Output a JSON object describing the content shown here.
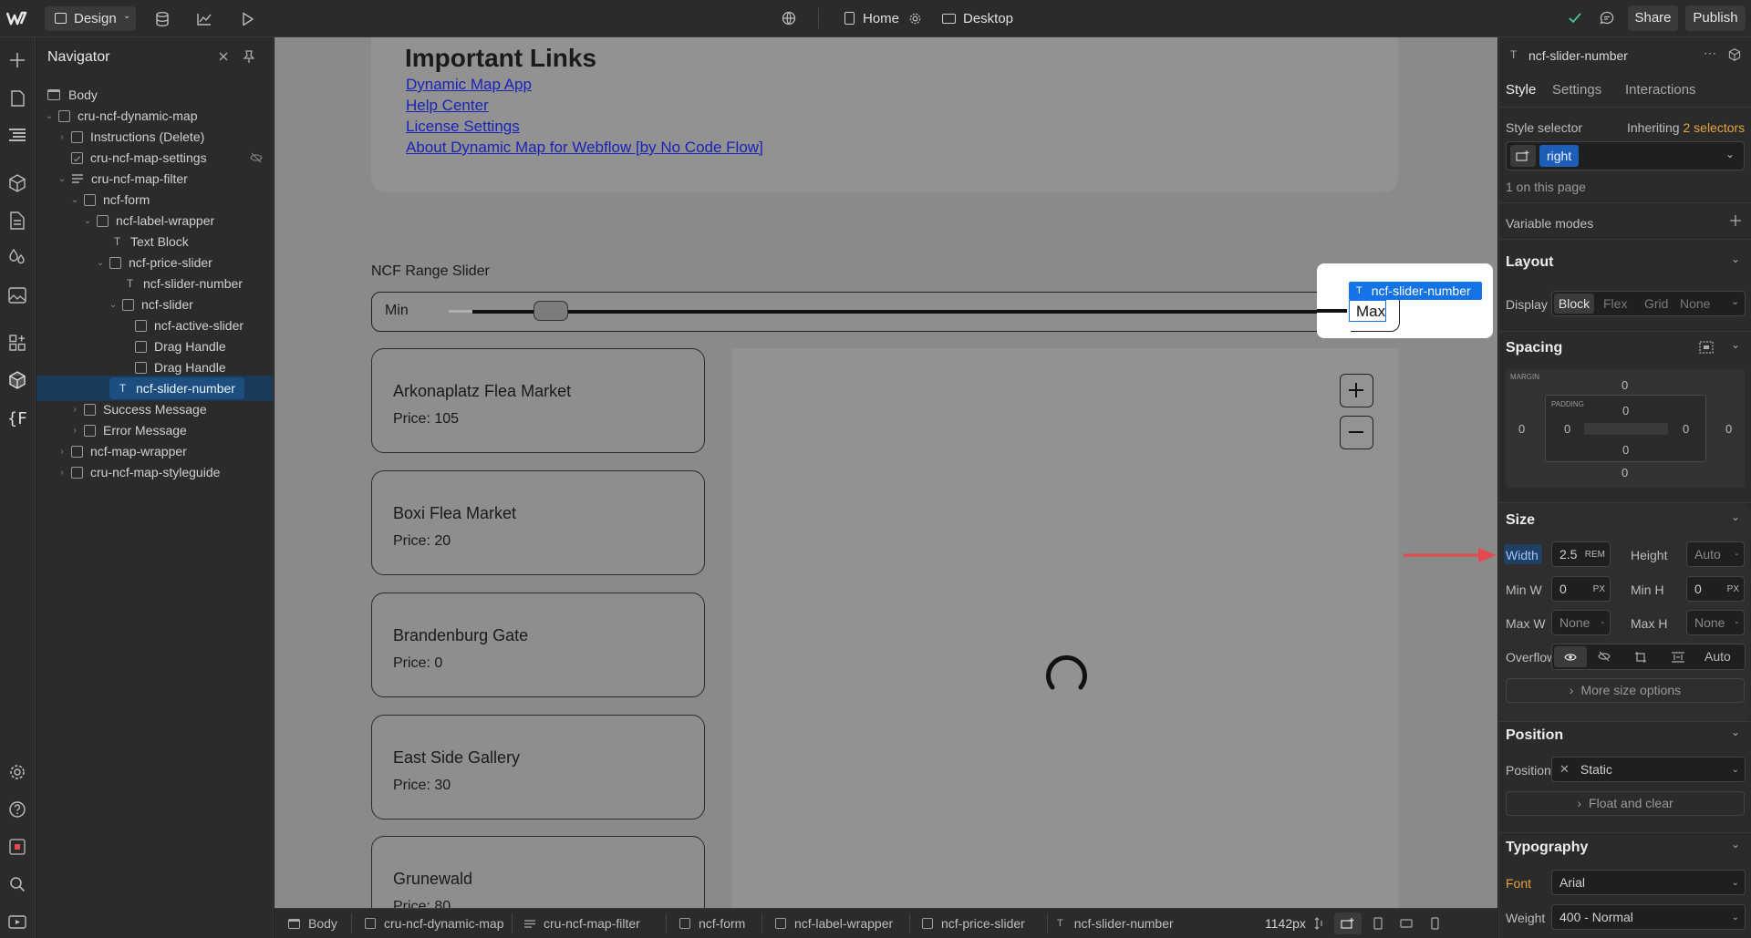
{
  "topbar": {
    "mode_label": "Design",
    "page_label": "Home",
    "device_label": "Desktop",
    "share_label": "Share",
    "publish_label": "Publish"
  },
  "navigator": {
    "title": "Navigator",
    "items": [
      {
        "label": "Body",
        "icon": "body"
      },
      {
        "label": "cru-ncf-dynamic-map",
        "icon": "box"
      },
      {
        "label": "Instructions (Delete)",
        "icon": "box"
      },
      {
        "label": "cru-ncf-map-settings",
        "icon": "embed"
      },
      {
        "label": "cru-ncf-map-filter",
        "icon": "form"
      },
      {
        "label": "ncf-form",
        "icon": "box"
      },
      {
        "label": "ncf-label-wrapper",
        "icon": "box"
      },
      {
        "label": "Text Block",
        "icon": "text"
      },
      {
        "label": "ncf-price-slider",
        "icon": "box"
      },
      {
        "label": "ncf-slider-number",
        "icon": "text"
      },
      {
        "label": "ncf-slider",
        "icon": "box"
      },
      {
        "label": "ncf-active-slider",
        "icon": "box"
      },
      {
        "label": "Drag Handle",
        "icon": "box"
      },
      {
        "label": "Drag Handle",
        "icon": "box"
      },
      {
        "label": "ncf-slider-number",
        "icon": "text"
      },
      {
        "label": "Success Message",
        "icon": "box"
      },
      {
        "label": "Error Message",
        "icon": "box"
      },
      {
        "label": "ncf-map-wrapper",
        "icon": "box"
      },
      {
        "label": "cru-ncf-map-styleguide",
        "icon": "box"
      }
    ]
  },
  "canvas": {
    "links_heading": "Important Links",
    "links": [
      "Dynamic Map App",
      "Help Center",
      "License Settings",
      "About Dynamic Map for Webflow [by No Code Flow]"
    ],
    "slider_title": "NCF Range Slider",
    "slider_min": "Min",
    "slider_max": "Max",
    "selected_tag": "ncf-slider-number",
    "zoom_in": "+",
    "zoom_out": "−",
    "cards": [
      {
        "name": "Arkonaplatz Flea Market",
        "price": "Price: 105"
      },
      {
        "name": "Boxi Flea Market",
        "price": "Price: 20"
      },
      {
        "name": "Brandenburg Gate",
        "price": "Price: 0"
      },
      {
        "name": "East Side Gallery",
        "price": "Price: 30"
      },
      {
        "name": "Grunewald",
        "price": "Price: 80"
      }
    ]
  },
  "right_panel": {
    "element_name": "ncf-slider-number",
    "tabs": [
      "Style",
      "Settings",
      "Interactions"
    ],
    "style_selector_label": "Style selector",
    "inheriting_label": "Inheriting",
    "inheriting_count": "2 selectors",
    "selector_chip": "right",
    "on_page": "1 on this page",
    "variable_modes": "Variable modes",
    "layout": {
      "title": "Layout",
      "display_label": "Display",
      "options": [
        "Block",
        "Flex",
        "Grid",
        "None"
      ]
    },
    "spacing": {
      "title": "Spacing",
      "margin_label": "MARGIN",
      "padding_label": "PADDING",
      "margin": {
        "top": "0",
        "right": "0",
        "bottom": "0",
        "left": "0"
      },
      "padding": {
        "top": "0",
        "right": "0",
        "bottom": "0",
        "left": "0"
      }
    },
    "size": {
      "title": "Size",
      "width_label": "Width",
      "width_value": "2.5",
      "width_unit": "REM",
      "height_label": "Height",
      "height_value": "Auto",
      "minw_label": "Min W",
      "minw_value": "0",
      "minw_unit": "PX",
      "minh_label": "Min H",
      "minh_value": "0",
      "minh_unit": "PX",
      "maxw_label": "Max W",
      "maxw_value": "None",
      "maxh_label": "Max H",
      "maxh_value": "None",
      "overflow_label": "Overflow",
      "overflow_auto": "Auto",
      "more_label": "More size options"
    },
    "position": {
      "title": "Position",
      "label": "Position",
      "value": "Static",
      "float_label": "Float and clear"
    },
    "typography": {
      "title": "Typography",
      "font_label": "Font",
      "font_value": "Arial",
      "weight_label": "Weight",
      "weight_value": "400 - Normal"
    }
  },
  "bottombar": {
    "crumbs": [
      "Body",
      "cru-ncf-dynamic-map",
      "cru-ncf-map-filter",
      "ncf-form",
      "ncf-label-wrapper",
      "ncf-price-slider",
      "ncf-slider-number"
    ],
    "width_readout": "1142px"
  },
  "colors": {
    "accent": "#1473e6",
    "selection": "#1d4e80",
    "annotation_arrow": "#e5484d",
    "canvas_gray": "#8a8a8a",
    "inherit_orange": "#e8a33b"
  }
}
